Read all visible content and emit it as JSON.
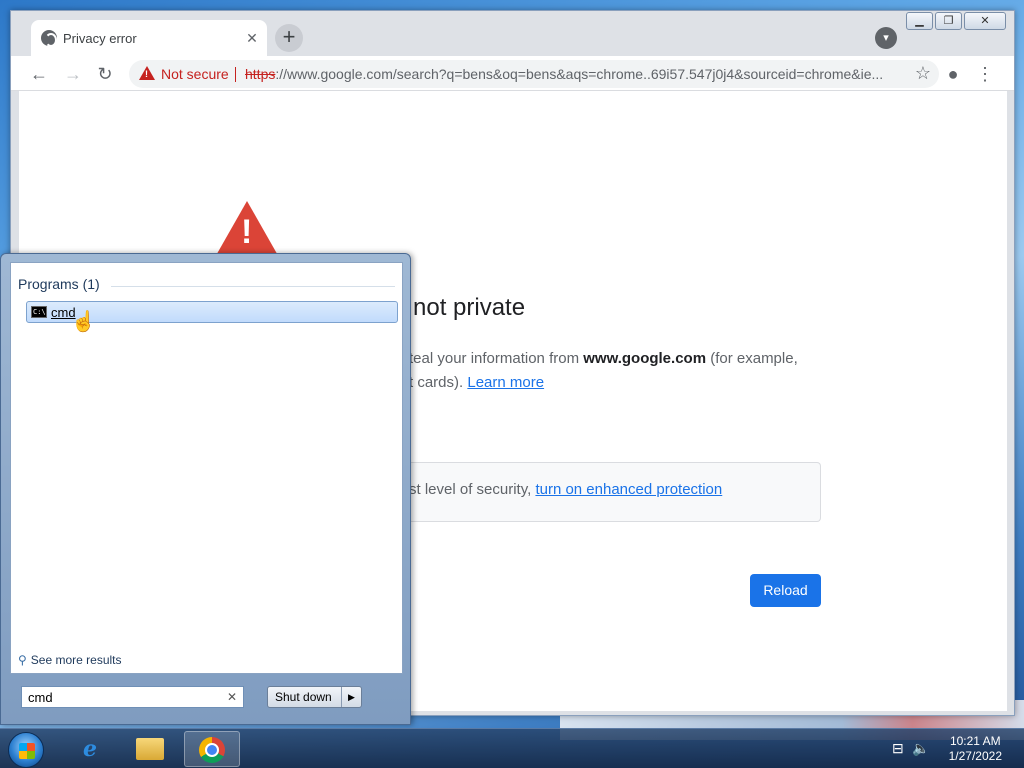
{
  "browser": {
    "tab_title": "Privacy error",
    "tab_close": "✕",
    "new_tab": "+",
    "window_controls": {
      "minimize": "▁",
      "restore": "❐",
      "close": "✕"
    },
    "omnibox": {
      "security_label": "Not secure",
      "url_scheme": "https",
      "url_rest": "://www.google.com/search?q=bens&oq=bens&aqs=chrome..69i57.547j0j4&sourceid=chrome&ie..."
    }
  },
  "page": {
    "heading": "not private",
    "line1_prefix": "teal your information from ",
    "line1_domain": "www.google.com",
    "line1_suffix": " (for example,",
    "line2_prefix": "t cards). ",
    "learn_more": "Learn more",
    "enhanced_prefix": "st level of security, ",
    "enhanced_link": "turn on enhanced protection",
    "reload_button": "Reload"
  },
  "start_menu": {
    "programs_title": "Programs (1)",
    "result_label": "cmd",
    "cmd_icon_text": "C:\\",
    "see_more": "See more results",
    "search_value": "cmd",
    "clear_icon": "✕",
    "shutdown_label": "Shut down",
    "shutdown_arrow": "▶"
  },
  "taskbar": {
    "clock_time": "10:21 AM",
    "clock_date": "1/27/2022",
    "apps": [
      "internet-explorer",
      "windows-explorer",
      "google-chrome"
    ]
  },
  "colors": {
    "danger": "#c5221f",
    "link": "#1a73e8",
    "reload_bg": "#1a73e8"
  }
}
